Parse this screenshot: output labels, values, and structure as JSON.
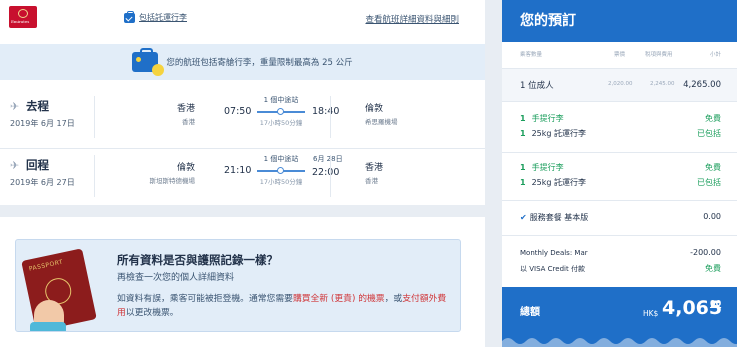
{
  "airline": {
    "logo_text": "Emirates"
  },
  "top_links": {
    "baggage_included": "包括託運行李",
    "flight_details": "查看航班詳細資料與細則"
  },
  "notice": {
    "text": "您的航班包括寄艙行李，重量限制最高為 25 公斤"
  },
  "flights": [
    {
      "direction": "去程",
      "date": "2019年 6月 17日",
      "from_city": "香港",
      "from_airport": "香港",
      "dep_time": "07:50",
      "stops": "1 個中途站",
      "duration": "17小時50分鐘",
      "arr_time": "18:40",
      "next_day": "",
      "to_city": "倫敦",
      "to_airport": "希思羅機場"
    },
    {
      "direction": "回程",
      "date": "2019年 6月 27日",
      "from_city": "倫敦",
      "from_airport": "斯坦斯特德機場",
      "dep_time": "21:10",
      "stops": "1 個中途站",
      "duration": "17小時50分鐘",
      "arr_time": "22:00",
      "next_day": "6月 28日",
      "to_city": "香港",
      "to_airport": "香港"
    }
  ],
  "passport": {
    "title": "所有資料是否與護照記錄一樣？",
    "subtitle": "再檢查一次您的個人詳細資料",
    "body_1": "如資料有誤，乘客可能被拒登機。通常您需要",
    "body_red_1": "購買全新 (更貴) 的機票",
    "body_2": "，或",
    "body_red_2": "支付額外費用",
    "body_3": "以更改機票。",
    "image_text": "PASSPORT"
  },
  "booking": {
    "title": "您的預訂",
    "col_passengers": "乘客數量",
    "col_fare": "票價",
    "col_tax": "稅項與費用",
    "col_subtotal": "小計",
    "adult_label": "1 位成人",
    "fare": "2,020.00",
    "tax": "2,245.00",
    "subtotal": "4,265.00",
    "bags": [
      {
        "carry_qty": "1",
        "carry_label": "手提行李",
        "carry_value": "免費",
        "check_qty": "1",
        "check_label": "25kg 託運行李",
        "check_value": "已包括"
      },
      {
        "carry_qty": "1",
        "carry_label": "手提行李",
        "carry_value": "免費",
        "check_qty": "1",
        "check_label": "25kg 託運行李",
        "check_value": "已包括"
      }
    ],
    "service_label": "服務套餐 基本版",
    "service_value": "0.00",
    "deal_label": "Monthly Deals: Mar",
    "deal_value": "-200.00",
    "visa_label": "以 VISA Credit 付款",
    "visa_value": "免費",
    "total_label": "總額",
    "currency": "HK$",
    "total_amount": "4,065",
    "total_decimal": "00"
  },
  "colors": {
    "primary_blue": "#1f6fc8",
    "green": "#1b9e5c",
    "red": "#d0373a",
    "light_blue": "#e2edf8"
  }
}
